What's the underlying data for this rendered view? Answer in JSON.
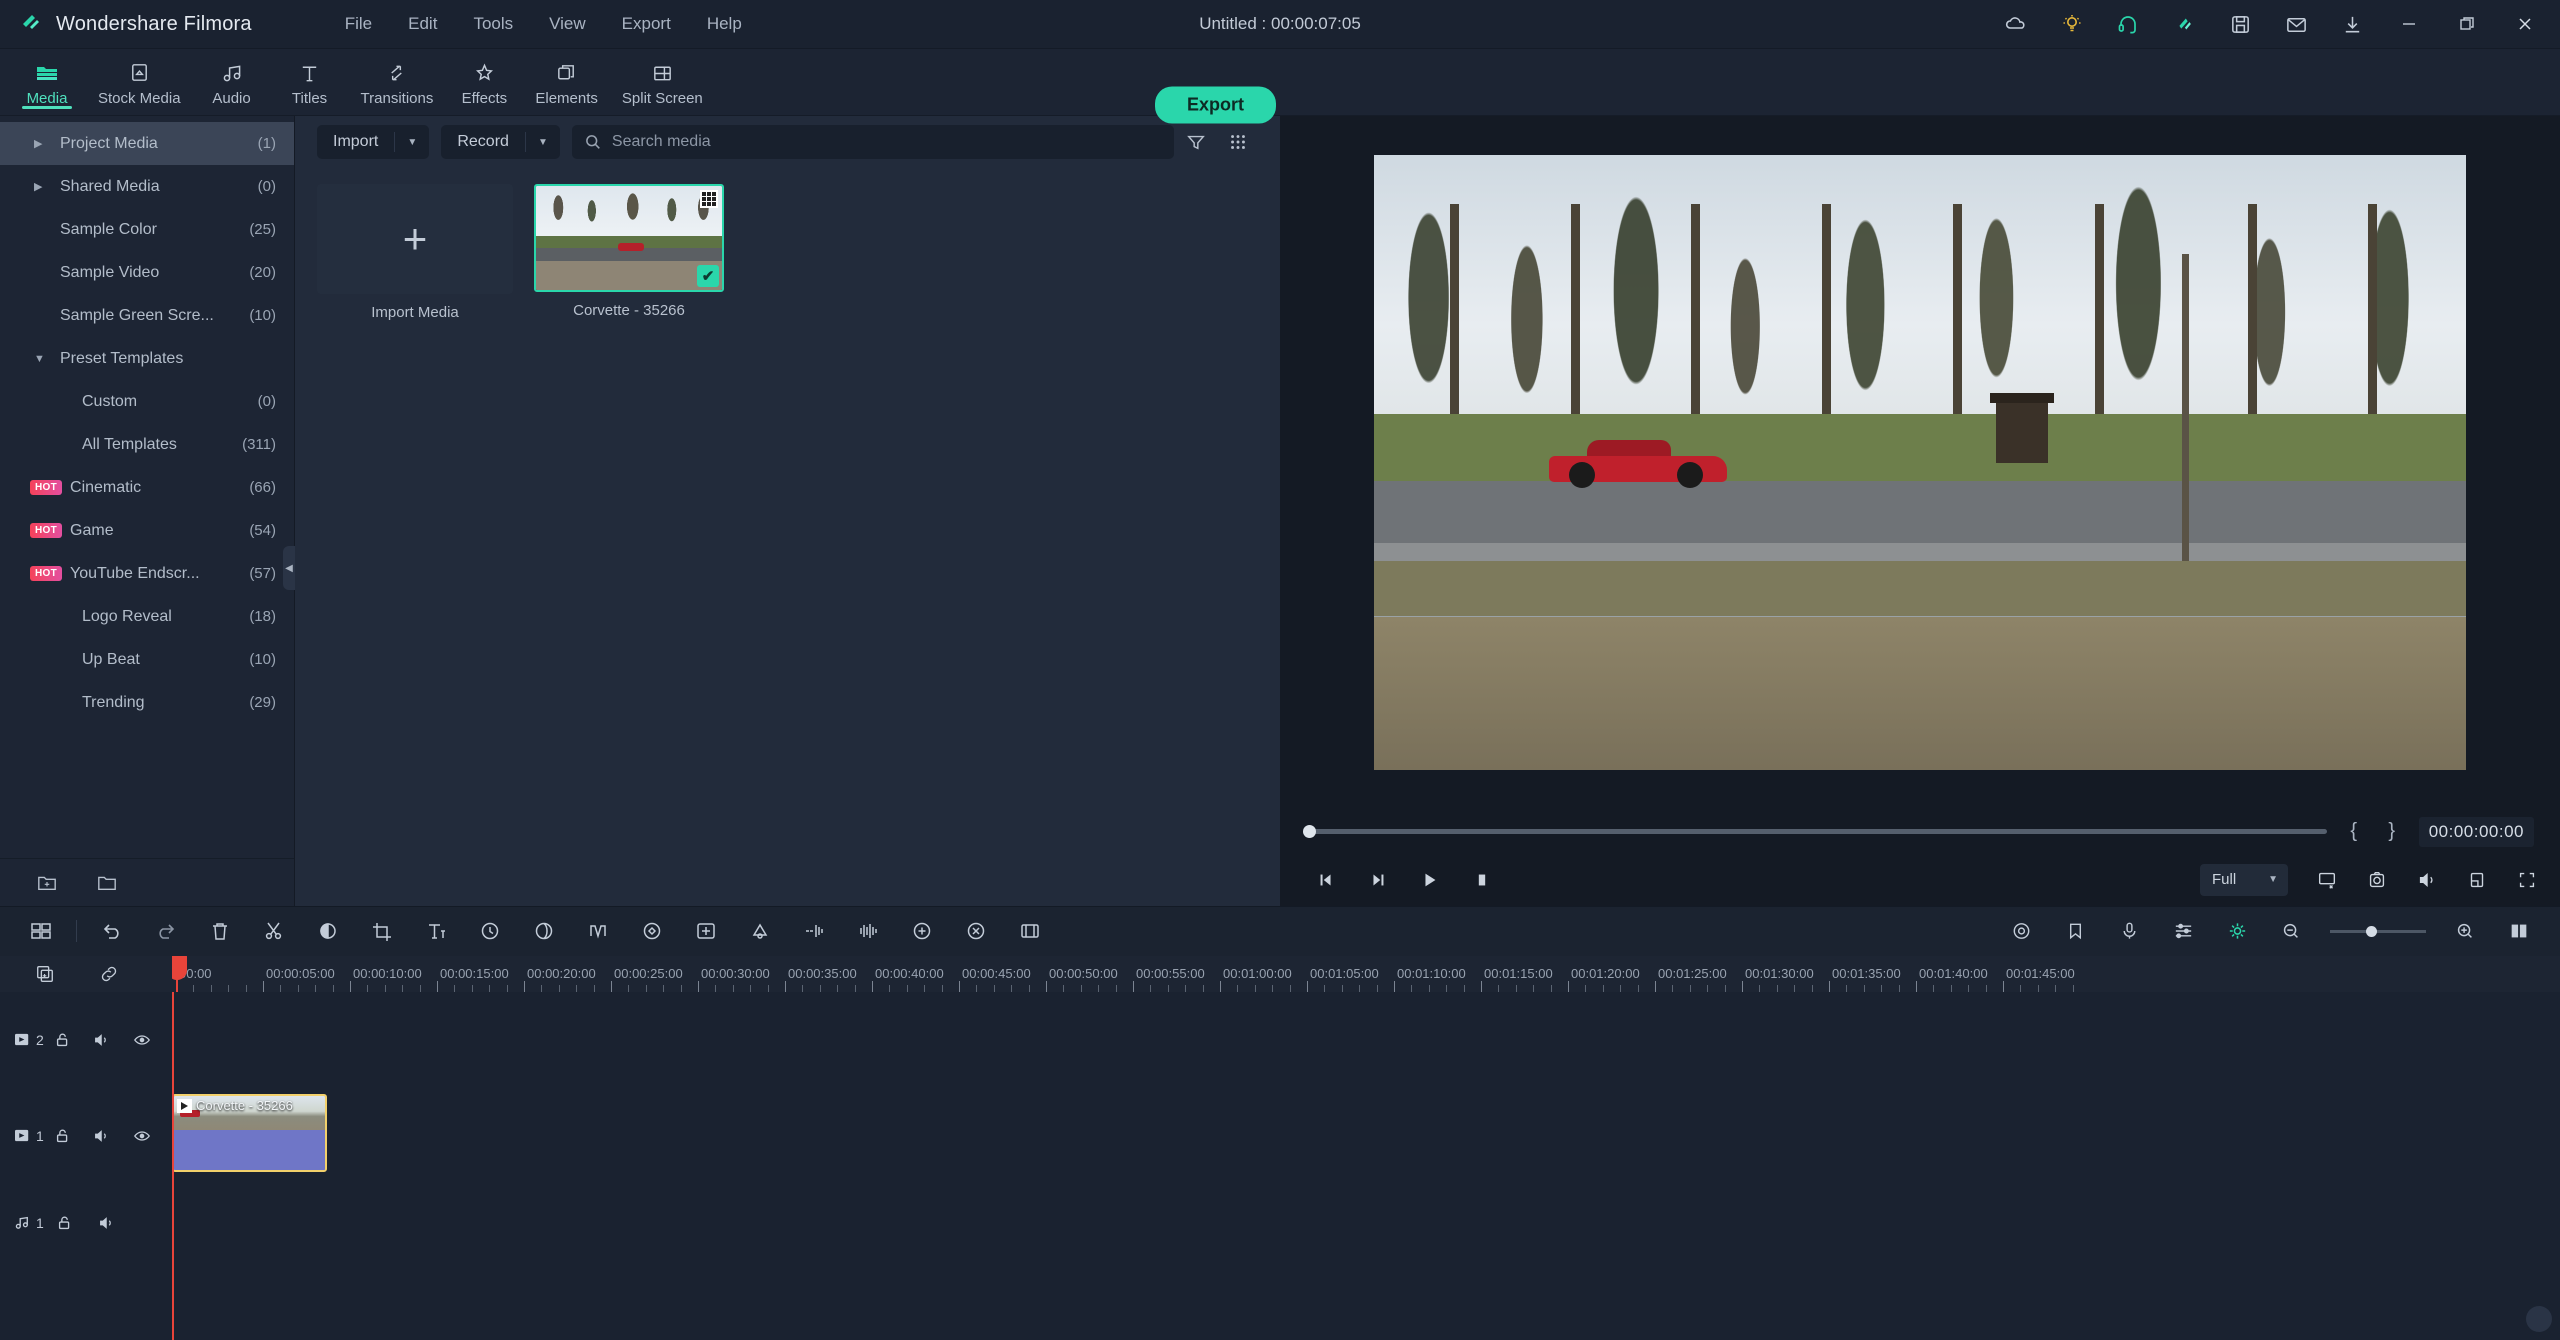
{
  "titlebar": {
    "app_name": "Wondershare Filmora",
    "menus": [
      "File",
      "Edit",
      "Tools",
      "View",
      "Export",
      "Help"
    ],
    "document_title": "Untitled : 00:00:07:05",
    "right_icons": [
      "cloud-icon",
      "lightbulb-icon",
      "headset-icon",
      "filmora-spark-icon",
      "save-icon",
      "mail-icon",
      "download-icon"
    ],
    "window_controls": [
      "minimize-button",
      "restore-button",
      "close-button"
    ]
  },
  "tabs": [
    {
      "label": "Media",
      "icon": "folder-icon",
      "active": true
    },
    {
      "label": "Stock Media",
      "icon": "stock-media-icon",
      "active": false
    },
    {
      "label": "Audio",
      "icon": "music-note-icon",
      "active": false
    },
    {
      "label": "Titles",
      "icon": "text-t-icon",
      "active": false
    },
    {
      "label": "Transitions",
      "icon": "transition-arrows-icon",
      "active": false
    },
    {
      "label": "Effects",
      "icon": "magic-star-icon",
      "active": false
    },
    {
      "label": "Elements",
      "icon": "elements-stack-icon",
      "active": false
    },
    {
      "label": "Split Screen",
      "icon": "split-screen-icon",
      "active": false
    }
  ],
  "export_button": "Export",
  "sidebar": {
    "items": [
      {
        "label": "Project Media",
        "count": "(1)",
        "arrow": "right",
        "selected": true,
        "indent": false,
        "hot": false
      },
      {
        "label": "Shared Media",
        "count": "(0)",
        "arrow": "right",
        "selected": false,
        "indent": false,
        "hot": false
      },
      {
        "label": "Sample Color",
        "count": "(25)",
        "arrow": "none",
        "selected": false,
        "indent": false,
        "hot": false
      },
      {
        "label": "Sample Video",
        "count": "(20)",
        "arrow": "none",
        "selected": false,
        "indent": false,
        "hot": false
      },
      {
        "label": "Sample Green Scre...",
        "count": "(10)",
        "arrow": "none",
        "selected": false,
        "indent": false,
        "hot": false
      },
      {
        "label": "Preset Templates",
        "count": "",
        "arrow": "down",
        "selected": false,
        "indent": false,
        "hot": false
      },
      {
        "label": "Custom",
        "count": "(0)",
        "arrow": "none",
        "selected": false,
        "indent": true,
        "hot": false
      },
      {
        "label": "All Templates",
        "count": "(311)",
        "arrow": "none",
        "selected": false,
        "indent": true,
        "hot": false
      },
      {
        "label": "Cinematic",
        "count": "(66)",
        "arrow": "none",
        "selected": false,
        "indent": false,
        "hot": true
      },
      {
        "label": "Game",
        "count": "(54)",
        "arrow": "none",
        "selected": false,
        "indent": false,
        "hot": true
      },
      {
        "label": "YouTube Endscr...",
        "count": "(57)",
        "arrow": "none",
        "selected": false,
        "indent": false,
        "hot": true
      },
      {
        "label": "Logo Reveal",
        "count": "(18)",
        "arrow": "none",
        "selected": false,
        "indent": true,
        "hot": false
      },
      {
        "label": "Up Beat",
        "count": "(10)",
        "arrow": "none",
        "selected": false,
        "indent": true,
        "hot": false
      },
      {
        "label": "Trending",
        "count": "(29)",
        "arrow": "none",
        "selected": false,
        "indent": true,
        "hot": false
      }
    ],
    "hot_badge_text": "HOT",
    "bottom_icons": [
      "new-folder-icon",
      "open-folder-icon"
    ]
  },
  "media_panel": {
    "import_button": "Import",
    "record_button": "Record",
    "search_placeholder": "Search media",
    "filter_icon": "filter-icon",
    "grid_view_icon": "grid-view-icon",
    "import_tile_label": "Import Media",
    "items": [
      {
        "name": "Corvette - 35266",
        "selected": true
      }
    ]
  },
  "preview": {
    "timecode": "00:00:00:00",
    "in_brace": "{",
    "out_brace": "}",
    "quality_label": "Full",
    "controls": [
      "prev-frame-button",
      "next-frame-button",
      "play-button",
      "stop-button"
    ],
    "right_icons": [
      "screen-cast-icon",
      "snapshot-icon",
      "volume-icon",
      "crop-icon",
      "fullscreen-icon"
    ]
  },
  "timeline": {
    "toolbar_icons_left": [
      "timeline-layout-icon",
      "undo-icon",
      "redo-icon",
      "delete-icon",
      "split-scissors-icon",
      "crop-icon",
      "text-icon",
      "speed-icon",
      "color-icon",
      "mask-icon",
      "animation-icon",
      "keyframe-icon",
      "green-screen-icon",
      "audio-detach-icon",
      "auto-enhance-icon",
      "audio-mix-icon",
      "marker-icon",
      "stabilize-icon",
      "render-icon"
    ],
    "toolbar_icons_right": [
      "settings-icon",
      "marker-add-icon",
      "voiceover-icon",
      "audio-mixer-icon",
      "auto-reframe-icon",
      "zoom-out-icon",
      "zoom-in-icon",
      "fit-timeline-icon"
    ],
    "header_icons": [
      "add-track-icon",
      "link-icon"
    ],
    "ruler_labels": [
      "00:00",
      "00:00:05:00",
      "00:00:10:00",
      "00:00:15:00",
      "00:00:20:00",
      "00:00:25:00",
      "00:00:30:00",
      "00:00:35:00",
      "00:00:40:00",
      "00:00:45:00",
      "00:00:50:00",
      "00:00:55:00",
      "00:01:00:00",
      "00:01:05:00",
      "00:01:10:00",
      "00:01:15:00",
      "00:01:20:00",
      "00:01:25:00",
      "00:01:30:00",
      "00:01:35:00",
      "00:01:40:00",
      "00:01:45:00"
    ],
    "tracks": [
      {
        "type": "video",
        "number": "2",
        "icons": [
          "video-track-icon",
          "lock-icon",
          "mute-icon",
          "eye-icon"
        ],
        "clips": []
      },
      {
        "type": "video",
        "number": "1",
        "icons": [
          "video-track-icon",
          "lock-icon",
          "mute-icon",
          "eye-icon"
        ],
        "clips": [
          {
            "label": "Corvette - 35266"
          }
        ]
      },
      {
        "type": "audio",
        "number": "1",
        "icons": [
          "audio-track-icon",
          "lock-icon",
          "mute-icon"
        ],
        "clips": []
      }
    ]
  },
  "colors": {
    "accent": "#2ad6ab",
    "playhead": "#e8443a",
    "clip_border": "#f2d06b",
    "clip_body": "#6f76c7",
    "hot_badge": "#e34fa0"
  }
}
